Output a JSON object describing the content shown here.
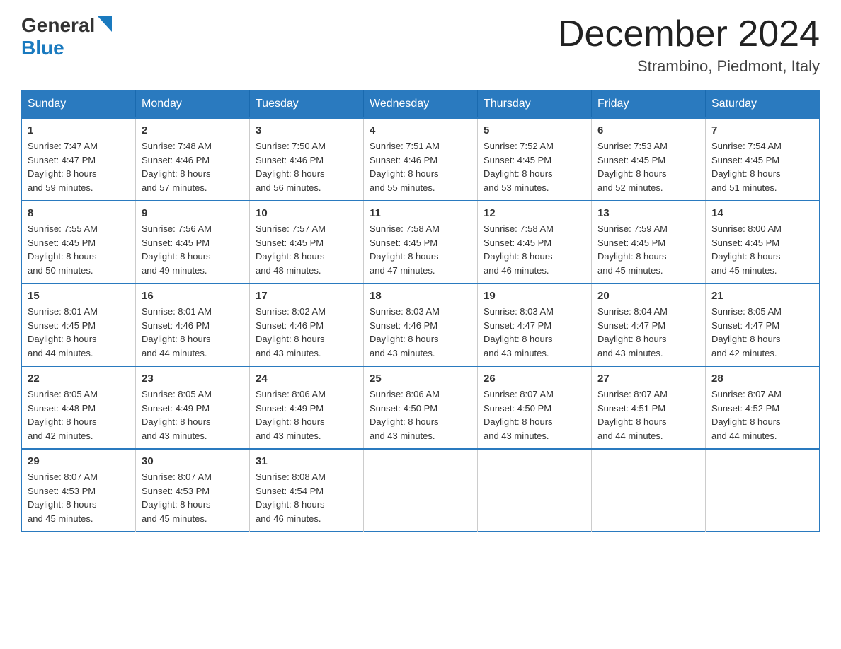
{
  "header": {
    "logo_general": "General",
    "logo_blue": "Blue",
    "title": "December 2024",
    "subtitle": "Strambino, Piedmont, Italy"
  },
  "days_of_week": [
    "Sunday",
    "Monday",
    "Tuesday",
    "Wednesday",
    "Thursday",
    "Friday",
    "Saturday"
  ],
  "weeks": [
    [
      {
        "day": "1",
        "sunrise": "7:47 AM",
        "sunset": "4:47 PM",
        "daylight_h": "8",
        "daylight_m": "59"
      },
      {
        "day": "2",
        "sunrise": "7:48 AM",
        "sunset": "4:46 PM",
        "daylight_h": "8",
        "daylight_m": "57"
      },
      {
        "day": "3",
        "sunrise": "7:50 AM",
        "sunset": "4:46 PM",
        "daylight_h": "8",
        "daylight_m": "56"
      },
      {
        "day": "4",
        "sunrise": "7:51 AM",
        "sunset": "4:46 PM",
        "daylight_h": "8",
        "daylight_m": "55"
      },
      {
        "day": "5",
        "sunrise": "7:52 AM",
        "sunset": "4:45 PM",
        "daylight_h": "8",
        "daylight_m": "53"
      },
      {
        "day": "6",
        "sunrise": "7:53 AM",
        "sunset": "4:45 PM",
        "daylight_h": "8",
        "daylight_m": "52"
      },
      {
        "day": "7",
        "sunrise": "7:54 AM",
        "sunset": "4:45 PM",
        "daylight_h": "8",
        "daylight_m": "51"
      }
    ],
    [
      {
        "day": "8",
        "sunrise": "7:55 AM",
        "sunset": "4:45 PM",
        "daylight_h": "8",
        "daylight_m": "50"
      },
      {
        "day": "9",
        "sunrise": "7:56 AM",
        "sunset": "4:45 PM",
        "daylight_h": "8",
        "daylight_m": "49"
      },
      {
        "day": "10",
        "sunrise": "7:57 AM",
        "sunset": "4:45 PM",
        "daylight_h": "8",
        "daylight_m": "48"
      },
      {
        "day": "11",
        "sunrise": "7:58 AM",
        "sunset": "4:45 PM",
        "daylight_h": "8",
        "daylight_m": "47"
      },
      {
        "day": "12",
        "sunrise": "7:58 AM",
        "sunset": "4:45 PM",
        "daylight_h": "8",
        "daylight_m": "46"
      },
      {
        "day": "13",
        "sunrise": "7:59 AM",
        "sunset": "4:45 PM",
        "daylight_h": "8",
        "daylight_m": "45"
      },
      {
        "day": "14",
        "sunrise": "8:00 AM",
        "sunset": "4:45 PM",
        "daylight_h": "8",
        "daylight_m": "45"
      }
    ],
    [
      {
        "day": "15",
        "sunrise": "8:01 AM",
        "sunset": "4:45 PM",
        "daylight_h": "8",
        "daylight_m": "44"
      },
      {
        "day": "16",
        "sunrise": "8:01 AM",
        "sunset": "4:46 PM",
        "daylight_h": "8",
        "daylight_m": "44"
      },
      {
        "day": "17",
        "sunrise": "8:02 AM",
        "sunset": "4:46 PM",
        "daylight_h": "8",
        "daylight_m": "43"
      },
      {
        "day": "18",
        "sunrise": "8:03 AM",
        "sunset": "4:46 PM",
        "daylight_h": "8",
        "daylight_m": "43"
      },
      {
        "day": "19",
        "sunrise": "8:03 AM",
        "sunset": "4:47 PM",
        "daylight_h": "8",
        "daylight_m": "43"
      },
      {
        "day": "20",
        "sunrise": "8:04 AM",
        "sunset": "4:47 PM",
        "daylight_h": "8",
        "daylight_m": "43"
      },
      {
        "day": "21",
        "sunrise": "8:05 AM",
        "sunset": "4:47 PM",
        "daylight_h": "8",
        "daylight_m": "42"
      }
    ],
    [
      {
        "day": "22",
        "sunrise": "8:05 AM",
        "sunset": "4:48 PM",
        "daylight_h": "8",
        "daylight_m": "42"
      },
      {
        "day": "23",
        "sunrise": "8:05 AM",
        "sunset": "4:49 PM",
        "daylight_h": "8",
        "daylight_m": "43"
      },
      {
        "day": "24",
        "sunrise": "8:06 AM",
        "sunset": "4:49 PM",
        "daylight_h": "8",
        "daylight_m": "43"
      },
      {
        "day": "25",
        "sunrise": "8:06 AM",
        "sunset": "4:50 PM",
        "daylight_h": "8",
        "daylight_m": "43"
      },
      {
        "day": "26",
        "sunrise": "8:07 AM",
        "sunset": "4:50 PM",
        "daylight_h": "8",
        "daylight_m": "43"
      },
      {
        "day": "27",
        "sunrise": "8:07 AM",
        "sunset": "4:51 PM",
        "daylight_h": "8",
        "daylight_m": "44"
      },
      {
        "day": "28",
        "sunrise": "8:07 AM",
        "sunset": "4:52 PM",
        "daylight_h": "8",
        "daylight_m": "44"
      }
    ],
    [
      {
        "day": "29",
        "sunrise": "8:07 AM",
        "sunset": "4:53 PM",
        "daylight_h": "8",
        "daylight_m": "45"
      },
      {
        "day": "30",
        "sunrise": "8:07 AM",
        "sunset": "4:53 PM",
        "daylight_h": "8",
        "daylight_m": "45"
      },
      {
        "day": "31",
        "sunrise": "8:08 AM",
        "sunset": "4:54 PM",
        "daylight_h": "8",
        "daylight_m": "46"
      },
      null,
      null,
      null,
      null
    ]
  ]
}
